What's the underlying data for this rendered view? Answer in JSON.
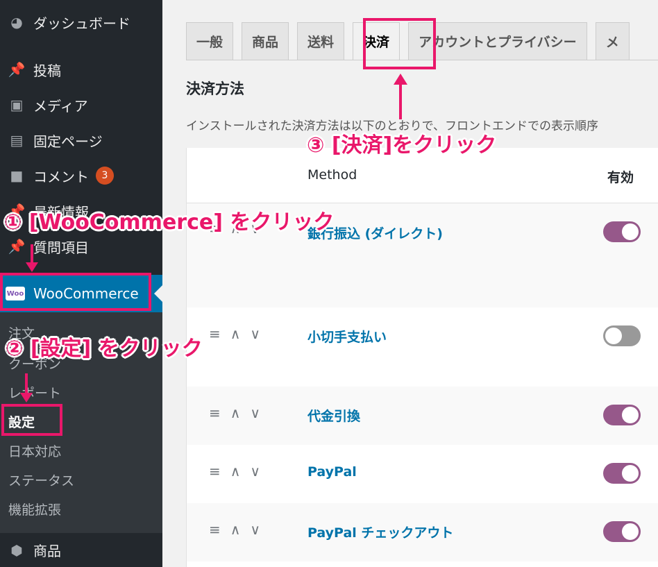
{
  "sidebar": {
    "items": [
      {
        "label": "ダッシュボード",
        "icon": "dashboard-icon",
        "glyph": "◕"
      },
      {
        "label": "投稿",
        "icon": "pin-icon",
        "glyph": "📌"
      },
      {
        "label": "メディア",
        "icon": "media-icon",
        "glyph": "▣"
      },
      {
        "label": "固定ページ",
        "icon": "page-icon",
        "glyph": "▤"
      },
      {
        "label": "コメント",
        "icon": "comment-icon",
        "glyph": "■",
        "badge": "3"
      },
      {
        "label": "最新情報",
        "icon": "pin-icon",
        "glyph": "📌"
      },
      {
        "label": "質問項目",
        "icon": "pin-icon",
        "glyph": "📌"
      }
    ],
    "woocommerce": {
      "label": "WooCommerce",
      "logo": "Woo"
    },
    "submenu": [
      "注文",
      "クーポン",
      "レポート",
      "設定",
      "日本対応",
      "ステータス",
      "機能拡張"
    ],
    "bottom_item": {
      "label": "商品",
      "glyph": "⬢"
    }
  },
  "tabs": [
    "一般",
    "商品",
    "送料",
    "決済",
    "アカウントとプライバシー",
    "メ"
  ],
  "section": {
    "title": "決済方法",
    "description": "インストールされた決済方法は以下のとおりで、フロントエンドでの表示順序"
  },
  "table": {
    "headers": {
      "method": "Method",
      "enabled": "有効"
    },
    "rows": [
      {
        "method": "銀行振込 (ダイレクト)",
        "enabled": true
      },
      {
        "method": "小切手支払い",
        "enabled": false
      },
      {
        "method": "代金引換",
        "enabled": true
      },
      {
        "method": "PayPal",
        "enabled": true
      },
      {
        "method": "PayPal チェックアウト",
        "enabled": true
      }
    ],
    "controls": {
      "drag": "≡",
      "up": "∧",
      "down": "∨"
    }
  },
  "annotations": {
    "step1": "① [WooCommerce] をクリック",
    "step2": "② [設定] をクリック",
    "step3": "③ [決済]をクリック"
  },
  "colors": {
    "sidebar_bg": "#23282d",
    "active_blue": "#0073aa",
    "toggle_on": "#96588a",
    "annotation": "#e9176a"
  }
}
